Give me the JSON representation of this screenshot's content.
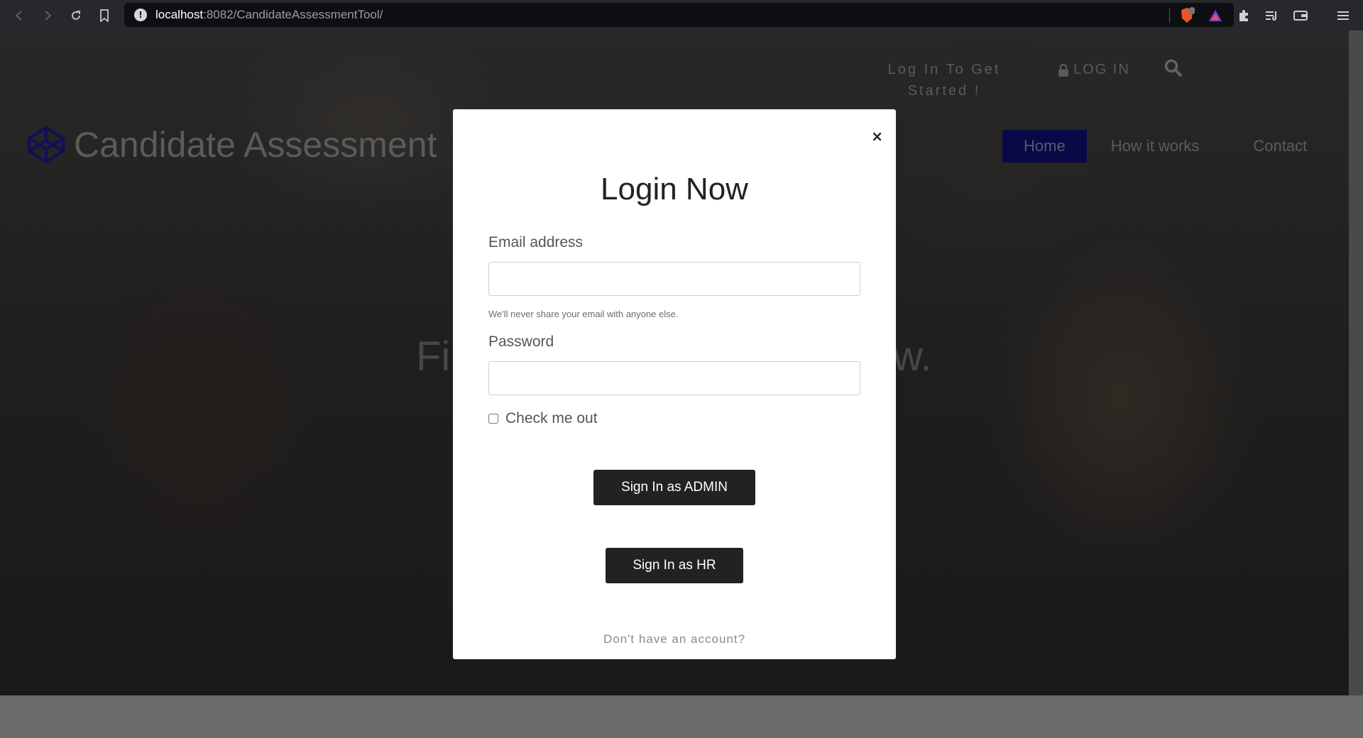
{
  "browser": {
    "url_host": "localhost",
    "url_rest": ":8082/CandidateAssessmentTool/",
    "brave_badge": "2"
  },
  "header": {
    "cta_text": "Log In To Get Started !",
    "login_label": "LOG IN",
    "brand_name": "Candidate Assessment",
    "menu": [
      {
        "label": "Home",
        "active": true
      },
      {
        "label": "How it works",
        "active": false
      },
      {
        "label": "Contact",
        "active": false
      }
    ]
  },
  "hero": {
    "title_visible_start": "Fir",
    "title_visible_end": "w."
  },
  "modal": {
    "close_label": "×",
    "title": "Login Now",
    "email_label": "Email address",
    "email_value": "",
    "email_hint": "We'll never share your email with anyone else.",
    "password_label": "Password",
    "password_value": "",
    "checkbox_label": "Check me out",
    "admin_button": "Sign In as ADMIN",
    "hr_button": "Sign In as HR",
    "signup_text": "Don't have an account?"
  },
  "colors": {
    "brand_accent": "#1a1a8a",
    "button_bg": "#222222",
    "active_nav_bg": "#0f0f6e"
  }
}
